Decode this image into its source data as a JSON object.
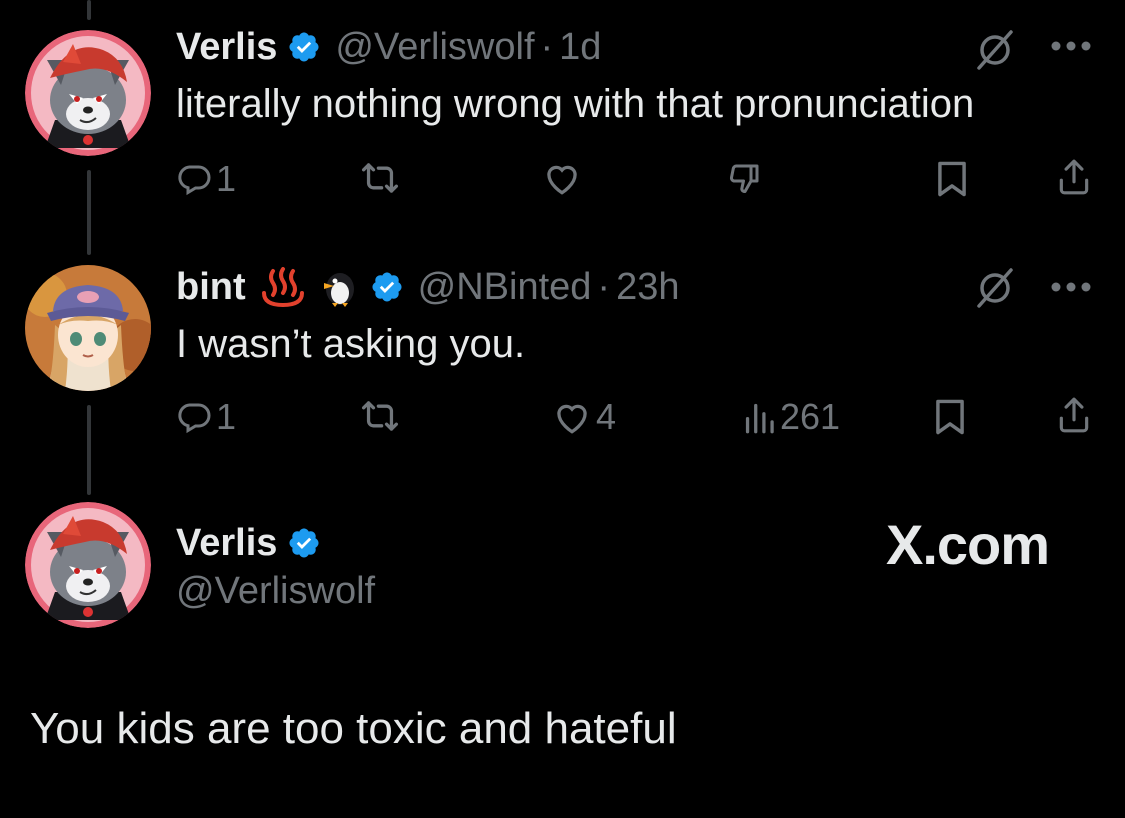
{
  "tweets": [
    {
      "name": "Verlis",
      "handle": "@Verliswolf",
      "time": "1d",
      "text": "literally nothing wrong with that pronunciation",
      "reply_count": "1",
      "like_count": "",
      "views": ""
    },
    {
      "name": "bint",
      "handle": "@NBinted",
      "time": "23h",
      "text": "I wasn’t asking you.",
      "reply_count": "1",
      "like_count": "4",
      "views": "261",
      "emoji": [
        "hot-springs",
        "penguin"
      ]
    }
  ],
  "card": {
    "name": "Verlis",
    "handle": "@Verliswolf",
    "brand": "X.com",
    "text": "You kids are too toxic and hateful"
  },
  "separator": "·",
  "colors": {
    "background": "#000000",
    "text": "#e7e9ea",
    "muted": "#71767b",
    "verified": "#1d9bf0",
    "thread_line": "#333639"
  }
}
